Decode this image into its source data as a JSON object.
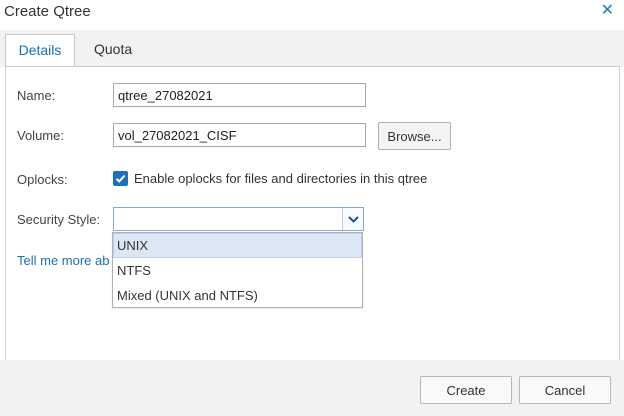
{
  "dialog": {
    "title": "Create Qtree",
    "close_glyph": "✕"
  },
  "tabs": [
    {
      "label": "Details",
      "active": true
    },
    {
      "label": "Quota",
      "active": false
    }
  ],
  "form": {
    "name_label": "Name:",
    "name_value": "qtree_27082021",
    "volume_label": "Volume:",
    "volume_value": "vol_27082021_CISF",
    "browse_label": "Browse...",
    "oplocks_label": "Oplocks:",
    "oplocks_checked": true,
    "oplocks_text": "Enable oplocks for files and directories in this qtree",
    "security_label": "Security Style:",
    "security_value": "",
    "security_options": [
      "UNIX",
      "NTFS",
      "Mixed (UNIX and NTFS)"
    ],
    "security_highlighted": "UNIX",
    "link_text": "Tell me more ab"
  },
  "footer": {
    "create_label": "Create",
    "cancel_label": "Cancel"
  },
  "colors": {
    "accent": "#1c6fb4",
    "header_bg": "#f2f2f2",
    "dropdown_highlight": "#dce6f5"
  },
  "icons": {
    "close": "close-icon",
    "checkbox": "checkmark-icon",
    "select_arrow": "chevron-down-icon"
  }
}
